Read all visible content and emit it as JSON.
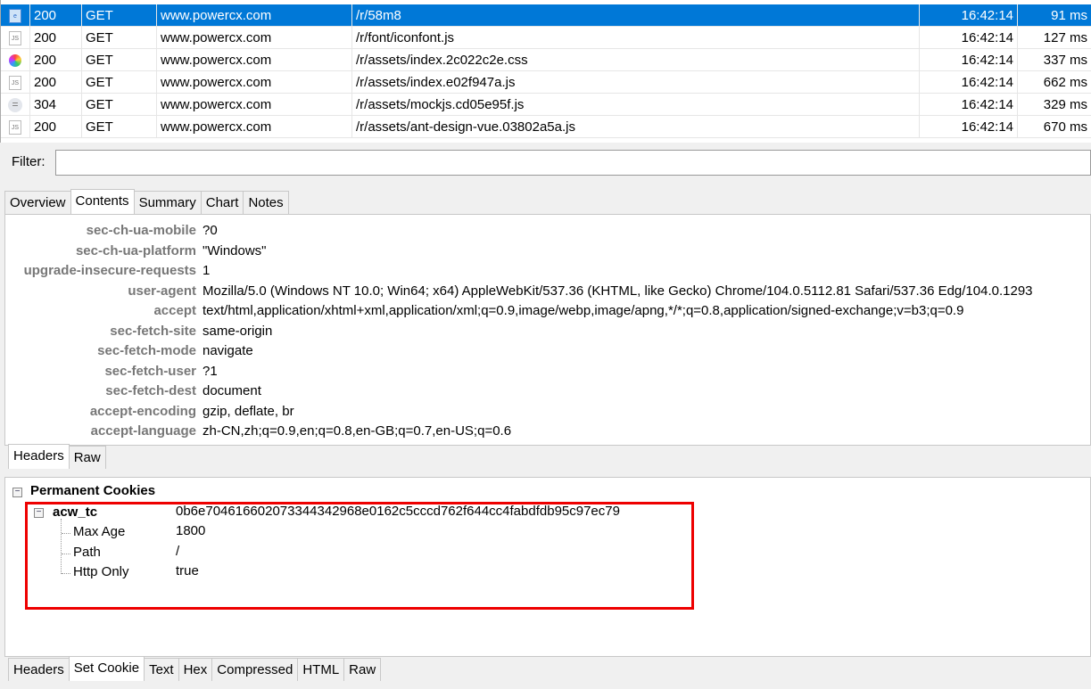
{
  "sessions": [
    {
      "icon": "webpage-icon",
      "status": "200",
      "method": "GET",
      "host": "www.powercx.com",
      "url": "/r/58m8",
      "time": "16:42:14",
      "duration": "91 ms",
      "selected": true
    },
    {
      "icon": "js-file-icon",
      "status": "200",
      "method": "GET",
      "host": "www.powercx.com",
      "url": "/r/font/iconfont.js",
      "time": "16:42:14",
      "duration": "127 ms"
    },
    {
      "icon": "css-file-icon",
      "status": "200",
      "method": "GET",
      "host": "www.powercx.com",
      "url": "/r/assets/index.2c022c2e.css",
      "time": "16:42:14",
      "duration": "337 ms"
    },
    {
      "icon": "js-file-icon",
      "status": "200",
      "method": "GET",
      "host": "www.powercx.com",
      "url": "/r/assets/index.e02f947a.js",
      "time": "16:42:14",
      "duration": "662 ms"
    },
    {
      "icon": "not-modified-icon",
      "status": "304",
      "method": "GET",
      "host": "www.powercx.com",
      "url": "/r/assets/mockjs.cd05e95f.js",
      "time": "16:42:14",
      "duration": "329 ms"
    },
    {
      "icon": "js-file-icon",
      "status": "200",
      "method": "GET",
      "host": "www.powercx.com",
      "url": "/r/assets/ant-design-vue.03802a5a.js",
      "time": "16:42:14",
      "duration": "670 ms"
    }
  ],
  "filter": {
    "label": "Filter:",
    "value": ""
  },
  "main_tabs": [
    "Overview",
    "Contents",
    "Summary",
    "Chart",
    "Notes"
  ],
  "main_tab_active": 1,
  "headers": [
    {
      "k": "sec-ch-ua-mobile",
      "v": "?0"
    },
    {
      "k": "sec-ch-ua-platform",
      "v": "\"Windows\""
    },
    {
      "k": "upgrade-insecure-requests",
      "v": "1"
    },
    {
      "k": "user-agent",
      "v": "Mozilla/5.0 (Windows NT 10.0; Win64; x64) AppleWebKit/537.36 (KHTML, like Gecko) Chrome/104.0.5112.81 Safari/537.36 Edg/104.0.1293"
    },
    {
      "k": "accept",
      "v": "text/html,application/xhtml+xml,application/xml;q=0.9,image/webp,image/apng,*/*;q=0.8,application/signed-exchange;v=b3;q=0.9"
    },
    {
      "k": "sec-fetch-site",
      "v": "same-origin"
    },
    {
      "k": "sec-fetch-mode",
      "v": "navigate"
    },
    {
      "k": "sec-fetch-user",
      "v": "?1"
    },
    {
      "k": "sec-fetch-dest",
      "v": "document"
    },
    {
      "k": "accept-encoding",
      "v": "gzip, deflate, br"
    },
    {
      "k": "accept-language",
      "v": "zh-CN,zh;q=0.9,en;q=0.8,en-GB;q=0.7,en-US;q=0.6"
    }
  ],
  "request_tabs": [
    "Headers",
    "Raw"
  ],
  "request_tab_active": 0,
  "cookies": {
    "group": "Permanent Cookies",
    "name": "acw_tc",
    "value": "0b6e704616602073344342968e0162c5cccd762f644cc4fabdfdb95c97ec79",
    "attrs": [
      {
        "k": "Max Age",
        "v": "1800"
      },
      {
        "k": "Path",
        "v": "/"
      },
      {
        "k": "Http Only",
        "v": "true"
      }
    ]
  },
  "response_tabs": [
    "Headers",
    "Set Cookie",
    "Text",
    "Hex",
    "Compressed",
    "HTML",
    "Raw"
  ],
  "response_tab_active": 1,
  "colors": {
    "selection": "#0078d7",
    "highlight_box": "#e00000"
  }
}
